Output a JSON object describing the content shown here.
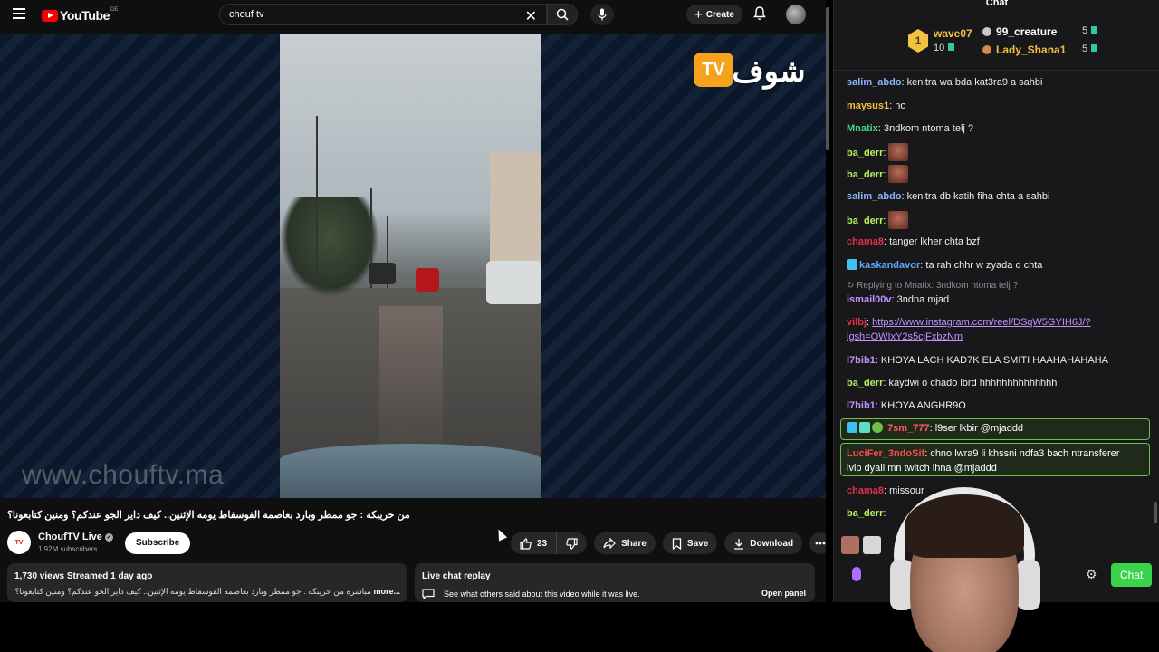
{
  "youtube": {
    "logo": "YouTube",
    "country_code": "DE",
    "search": {
      "value": "chouf tv"
    },
    "create_label": "Create",
    "video": {
      "watermark": "www.chouftv.ma",
      "channel_logo_text": "TV",
      "channel_logo_arabic": "شوف",
      "title": "من خريبكة : جو ممطر وبارد بعاصمة الفوسفاط يومه الإثنين.. كيف داير الجو عندكم؟ ومنين كتابعونا؟"
    },
    "channel": {
      "name": "ChoufTV  Live",
      "subscribers": "1.92M subscribers",
      "subscribe_label": "Subscribe"
    },
    "actions": {
      "like_count": "23",
      "share_label": "Share",
      "save_label": "Save",
      "download_label": "Download"
    },
    "description": {
      "stats": "1,730 views  Streamed 1 day ago",
      "text": "مباشرة من خريبكة : جو ممطر وبارد بعاصمة الفوسفاط يومه الإثنين.. كيف داير الجو عندكم؟ ومنين كتابعونا؟",
      "more": "...more"
    },
    "live_chat_replay": {
      "title": "Live chat replay",
      "text": "See what others said about this video while it was live.",
      "open_label": "Open panel"
    }
  },
  "chat": {
    "title": "Chat",
    "leaderboard": {
      "first": {
        "rank": "1",
        "user": "wave07",
        "count": "10"
      },
      "second": {
        "user": "99_creature",
        "count": "5"
      },
      "third": {
        "user": "Lady_Shana1",
        "count": "5"
      }
    },
    "messages": [
      {
        "user": "salim_abdo",
        "color": "#8ab4ff",
        "text": "kenitra wa bda kat3ra9 a sahbi"
      },
      {
        "user": "maysus1",
        "color": "#f3c141",
        "text": "no"
      },
      {
        "user": "Mnatix",
        "color": "#4ad48a",
        "text": "3ndkom ntoma telj ?"
      },
      {
        "user": "ba_derr",
        "color": "#b6f35d",
        "text": ""
      },
      {
        "user": "ba_derr",
        "color": "#b6f35d",
        "text": ""
      },
      {
        "user": "salim_abdo",
        "color": "#8ab4ff",
        "text": "kenitra db katih fiha chta a sahbi"
      },
      {
        "user": "ba_derr",
        "color": "#b6f35d",
        "text": ""
      },
      {
        "user": "chama8",
        "color": "#e2304a",
        "text": "tanger lkher chta bzf"
      },
      {
        "user": "kaskandavor",
        "color": "#5aa9ff",
        "text": "ta rah chhr w zyada d chta"
      },
      {
        "user": "ismail00v",
        "color": "#bf94ff",
        "text": "3ndna mjad",
        "reply_to": "Replying to Mnatix: 3ndkom ntoma telj ?"
      },
      {
        "user": "vilbj",
        "color": "#e2304a",
        "link": "https://www.instagram.com/reel/DSqW5GYIH6J/?",
        "link2": "igsh=OWIxY2s5cjFxbzNm"
      },
      {
        "user": "l7bib1",
        "color": "#bf94ff",
        "text": "KHOYA LACH KAD7K ELA SMITI HAAHAHAHAHA"
      },
      {
        "user": "ba_derr",
        "color": "#b6f35d",
        "text": "kaydwi o chado lbrd hhhhhhhhhhhhhh"
      },
      {
        "user": "l7bib1",
        "color": "#bf94ff",
        "text": "KHOYA ANGHR9O"
      },
      {
        "user": "7sm_777",
        "color": "#ff5e5e",
        "text": "l9ser lkbir @mjaddd"
      },
      {
        "user": "LuciFer_3ndoSif",
        "color": "#ff4a4a",
        "text": "chno lwra9 li khssni ndfa3 bach ntransferer",
        "text2": "lvip dyali mn twitch lhna @mjaddd"
      },
      {
        "user": "chama8",
        "color": "#e2304a",
        "text": "missour"
      },
      {
        "user": "ba_derr",
        "color": "#b6f35d",
        "text": ""
      }
    ],
    "chat_button": "Chat"
  }
}
